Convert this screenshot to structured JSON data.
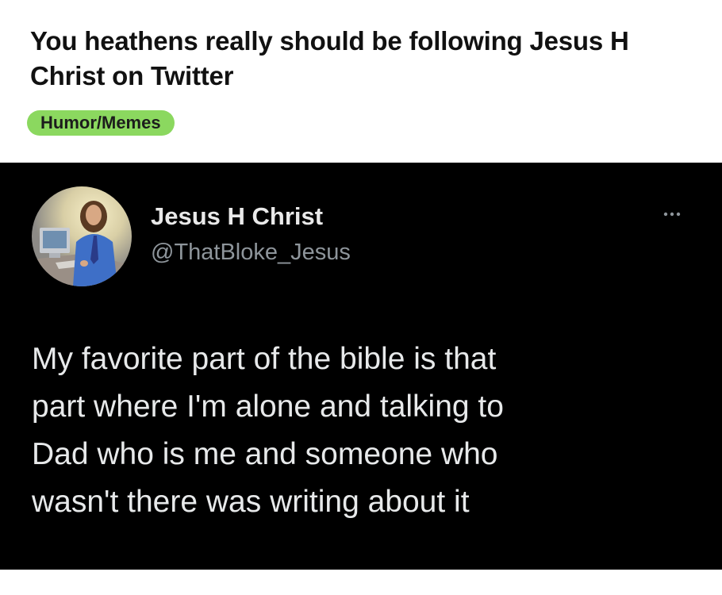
{
  "post": {
    "title": "You heathens really should be following Jesus H Christ on Twitter",
    "tag": "Humor/Memes",
    "tag_color": "#8bd85f"
  },
  "tweet": {
    "display_name": "Jesus H Christ",
    "handle": "@ThatBloke_Jesus",
    "text": "My favorite part of the bible is that\npart where I'm alone and talking to\nDad who is me and someone who\nwasn't there was writing about it",
    "avatar_icon": "avatar-jesus-at-computer",
    "more_icon": "more-options-icon",
    "background": "#000000"
  }
}
